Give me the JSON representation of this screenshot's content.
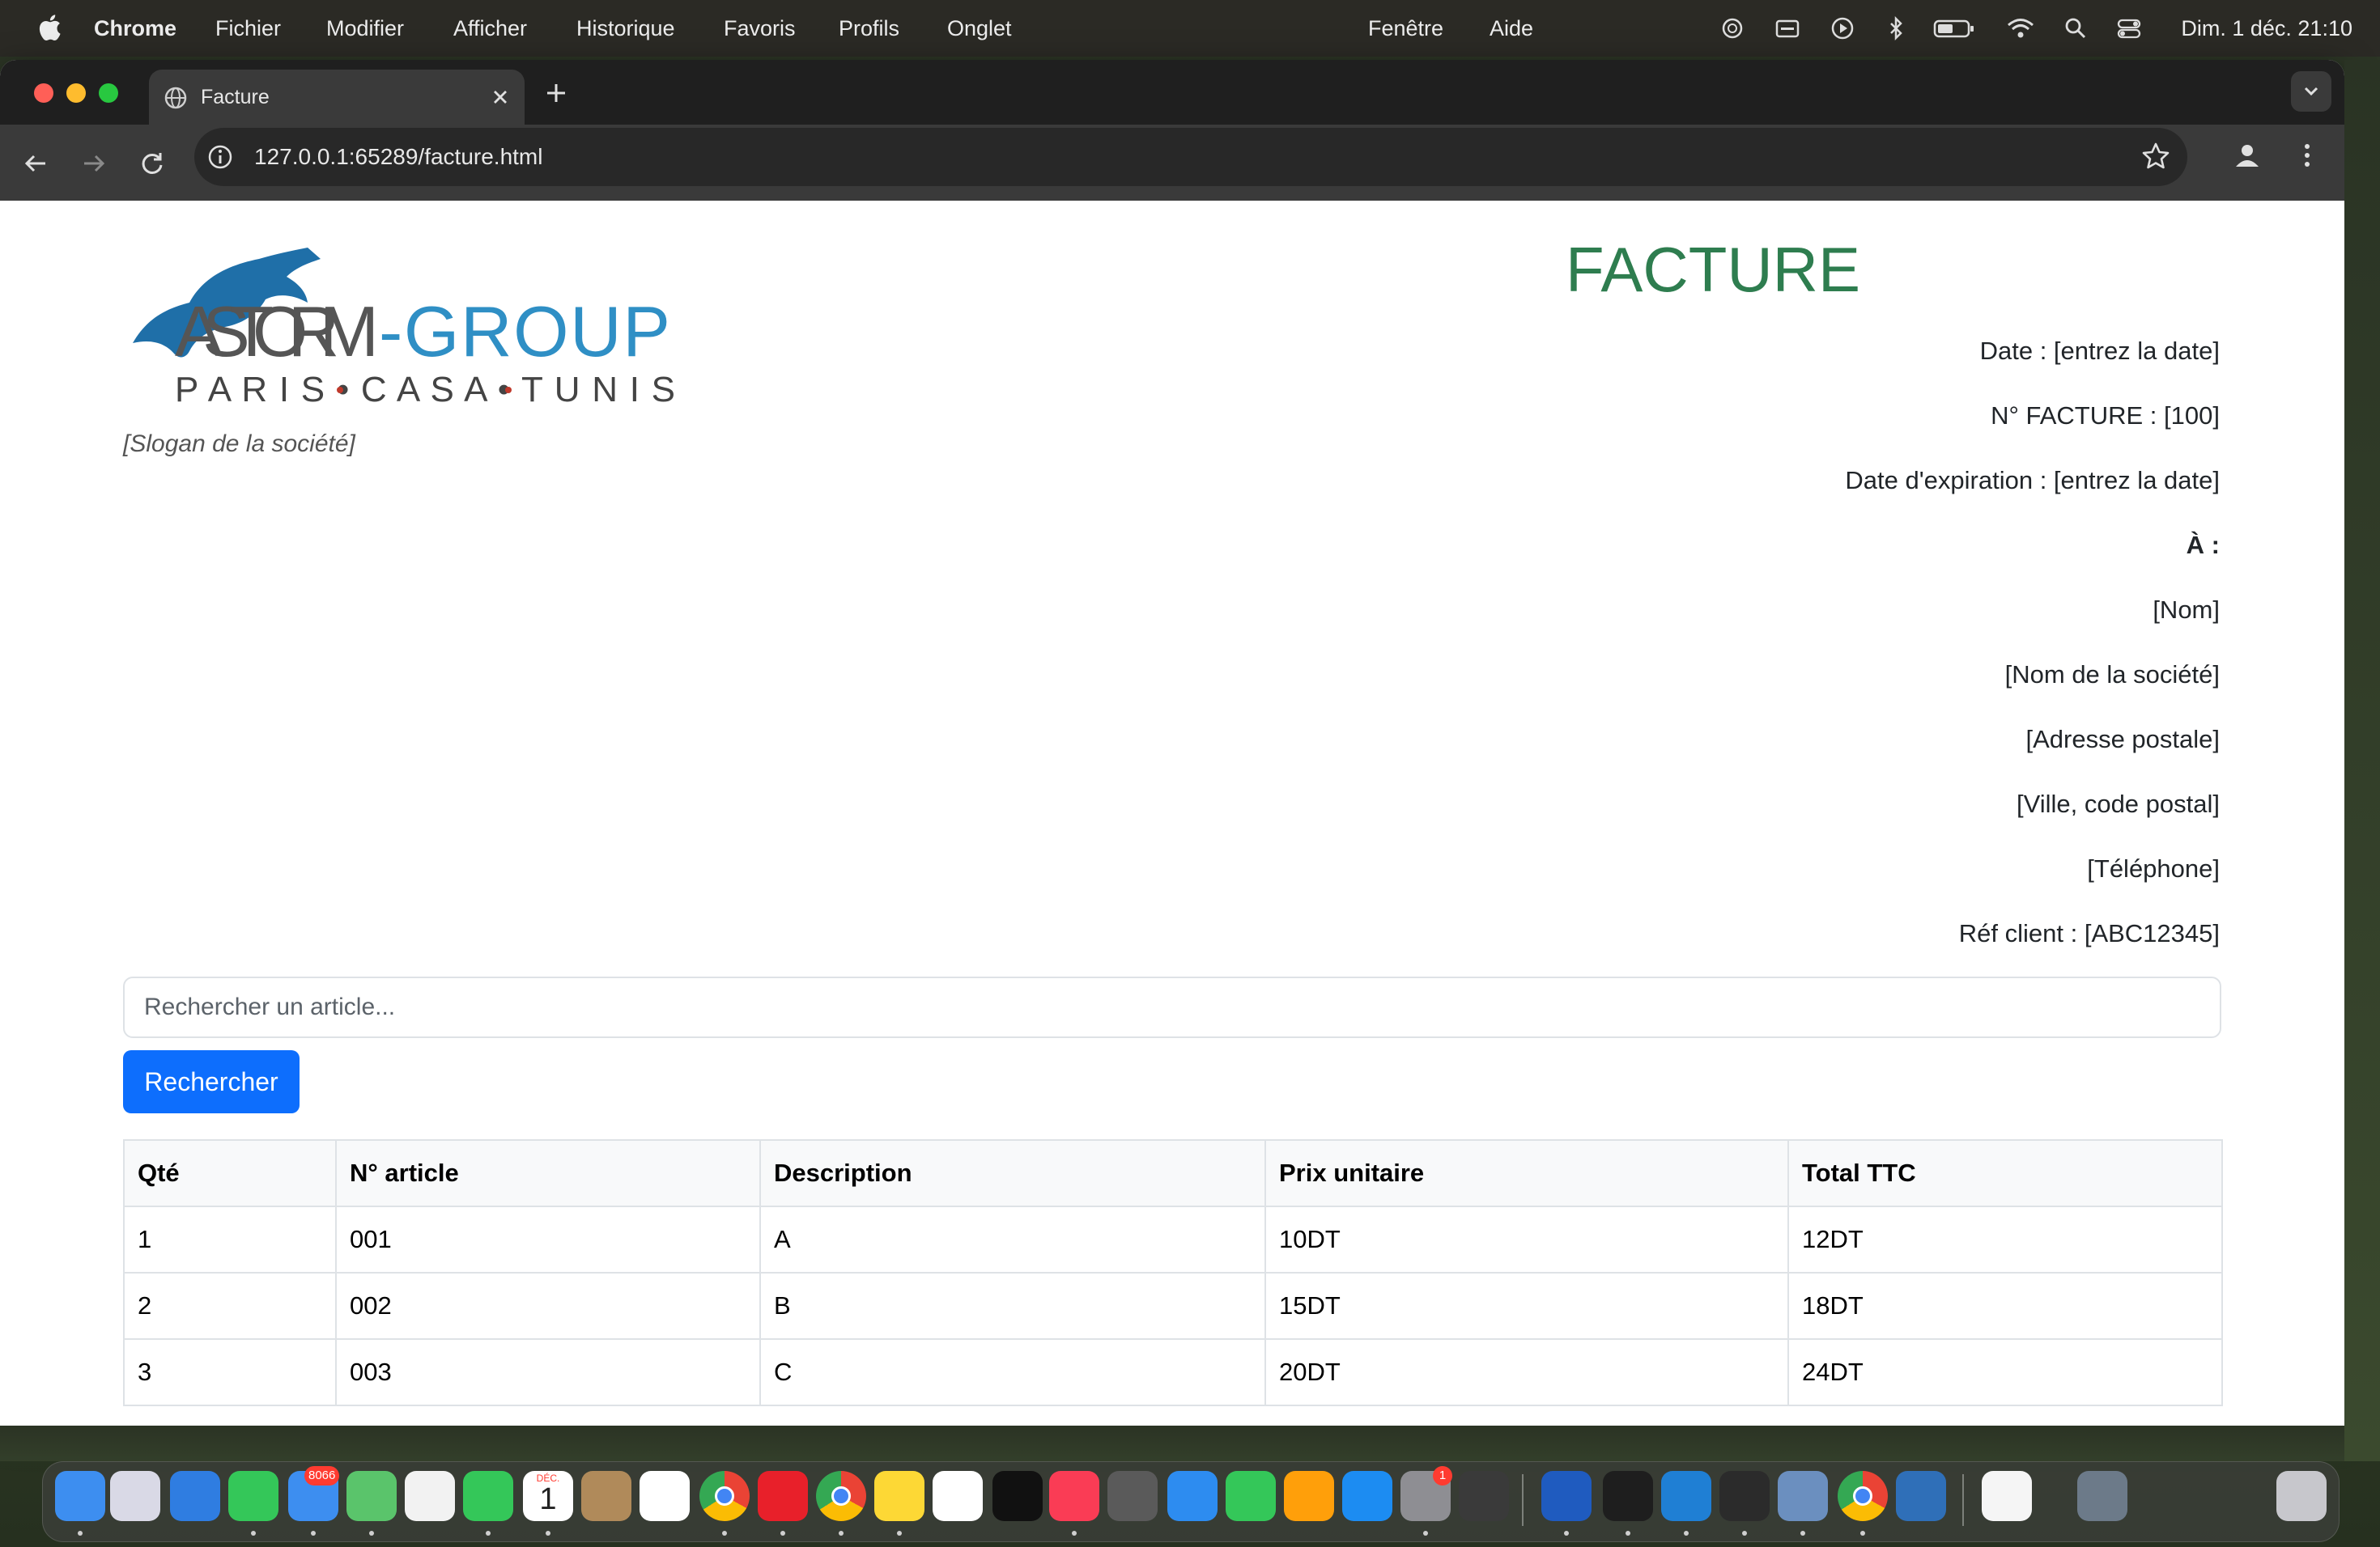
{
  "menubar": {
    "app_name": "Chrome",
    "items": [
      "Fichier",
      "Modifier",
      "Afficher",
      "Historique",
      "Favoris",
      "Profils",
      "Onglet",
      "Fenêtre",
      "Aide"
    ],
    "clock": "Dim. 1 déc.  21:10",
    "status_icons": [
      "chatgpt-icon",
      "keyboard-icon",
      "play-icon",
      "bluetooth-icon",
      "battery-icon",
      "wifi-icon",
      "spotlight-icon",
      "control-center-icon"
    ]
  },
  "browser": {
    "tab_title": "Facture",
    "url": "127.0.0.1:65289/facture.html"
  },
  "invoice": {
    "logo": {
      "brand": "ASTORM-GROUP",
      "cities": "PARIS•CASA•TUNIS"
    },
    "slogan": "[Slogan de la société]",
    "title": "FACTURE",
    "date": "Date : [entrez la date]",
    "number": "N° FACTURE : [100]",
    "expiry": "Date d'expiration : [entrez la date]",
    "to_label": "À :",
    "client_name": "[Nom]",
    "company_name": "[Nom de la société]",
    "address": "[Adresse postale]",
    "city": "[Ville, code postal]",
    "phone": "[Téléphone]",
    "client_ref": "Réf client : [ABC12345]"
  },
  "search": {
    "placeholder": "Rechercher un article...",
    "button": "Rechercher"
  },
  "table": {
    "headers": [
      "Qté",
      "N° article",
      "Description",
      "Prix unitaire",
      "Total TTC"
    ],
    "rows": [
      [
        "1",
        "001",
        "A",
        "10DT",
        "12DT"
      ],
      [
        "2",
        "002",
        "B",
        "15DT",
        "18DT"
      ],
      [
        "3",
        "003",
        "C",
        "20DT",
        "24DT"
      ]
    ]
  },
  "dock": {
    "mail_badge": "8066",
    "settings_badge": "1",
    "calendar_month": "DÉC.",
    "calendar_day": "1",
    "apps": [
      "finder",
      "launchpad",
      "safari",
      "messages",
      "mail",
      "maps",
      "photos",
      "facetime",
      "calendar",
      "contacts",
      "reminders",
      "chrome",
      "opera",
      "chrome-alt",
      "notes",
      "freeform",
      "tv",
      "music",
      "help",
      "keynote",
      "numbers",
      "pages",
      "app-store",
      "system-settings",
      "pen",
      "word",
      "terminal",
      "vscode",
      "chatgpt",
      "preview",
      "chrome-2",
      "screen-app",
      "document",
      "downloads-stack",
      "trash"
    ]
  },
  "colors": {
    "accent_green": "#2e7d4f",
    "button_blue": "#0d6efd",
    "logo_blue": "#2f8fc5"
  }
}
